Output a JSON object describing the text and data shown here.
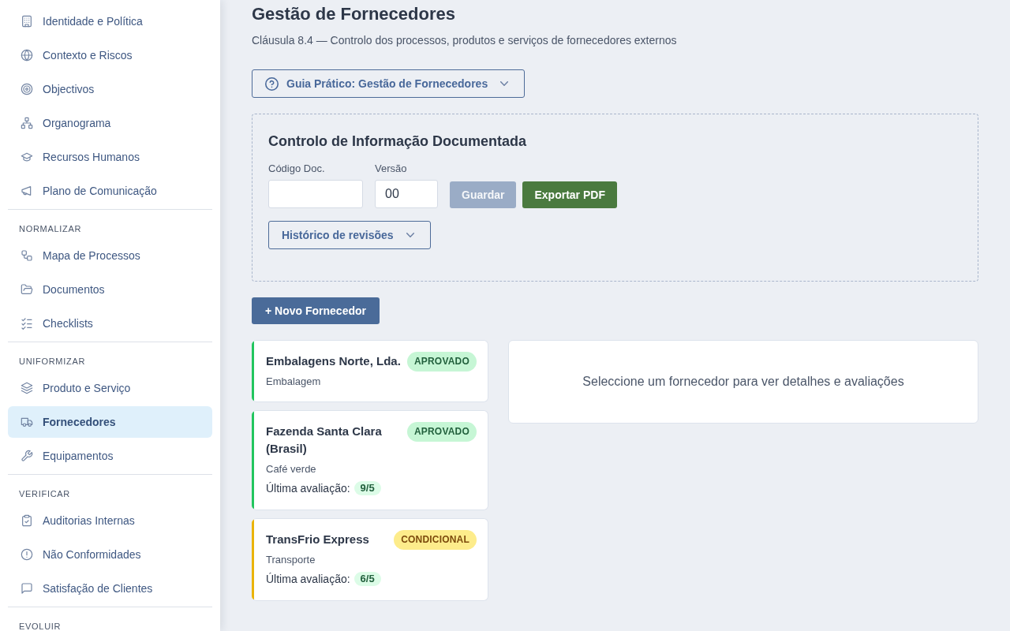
{
  "sidebar": {
    "sections": [
      {
        "items": [
          {
            "label": "Identidade e Política",
            "selected": false
          },
          {
            "label": "Contexto e Riscos",
            "selected": false
          },
          {
            "label": "Objectivos",
            "selected": false
          },
          {
            "label": "Organograma",
            "selected": false
          },
          {
            "label": "Recursos Humanos",
            "selected": false
          },
          {
            "label": "Plano de Comunicação",
            "selected": false
          }
        ]
      },
      {
        "heading": "NORMALIZAR",
        "items": [
          {
            "label": "Mapa de Processos",
            "selected": false
          },
          {
            "label": "Documentos",
            "selected": false
          },
          {
            "label": "Checklists",
            "selected": false
          }
        ]
      },
      {
        "heading": "UNIFORMIZAR",
        "items": [
          {
            "label": "Produto e Serviço",
            "selected": false
          },
          {
            "label": "Fornecedores",
            "selected": true
          },
          {
            "label": "Equipamentos",
            "selected": false
          }
        ]
      },
      {
        "heading": "VERIFICAR",
        "items": [
          {
            "label": "Auditorias Internas",
            "selected": false
          },
          {
            "label": "Não Conformidades",
            "selected": false
          },
          {
            "label": "Satisfação de Clientes",
            "selected": false
          }
        ]
      },
      {
        "heading": "EVOLUIR"
      }
    ]
  },
  "page": {
    "title": "Gestão de Fornecedores",
    "subtitle": "Cláusula 8.4 — Controlo dos processos, produtos e serviços de fornecedores externos"
  },
  "guide_button": {
    "label": "Guia Prático: Gestão de Fornecedores"
  },
  "document_control": {
    "title": "Controlo de Informação Documentada",
    "fields": [
      {
        "label": "Código Doc."
      },
      {
        "label": "Versão",
        "value": "00"
      }
    ],
    "buttons": [
      {
        "label": "Guardar",
        "kind": "primary",
        "disabled": true
      },
      {
        "label": "Exportar PDF",
        "kind": "success",
        "disabled": false
      }
    ],
    "history_button": {
      "label": "Histórico de revisões"
    }
  },
  "new_supplier_button": {
    "label": "+ Novo Fornecedor"
  },
  "suppliers": [
    {
      "name": "Embalagens Norte, Lda.",
      "category": "Embalagem",
      "color": "#22c55e",
      "selected": false,
      "status": {
        "label": "APROVADO",
        "kind": "approved"
      }
    },
    {
      "name": "Fazenda Santa Clara (Brasil)",
      "category": "Café verde",
      "color": "#22c55e",
      "selected": false,
      "status": {
        "label": "APROVADO",
        "kind": "approved"
      },
      "rating": {
        "label": "Última avaliação:",
        "value": "9/5"
      }
    },
    {
      "name": "TransFrio Express",
      "category": "Transporte",
      "color": "#eab308",
      "selected": false,
      "status": {
        "label": "CONDICIONAL",
        "kind": "conditional"
      },
      "rating": {
        "label": "Última avaliação:",
        "value": "6/5"
      }
    }
  ],
  "detail_panel": {
    "message": "Seleccione um fornecedor para ver detalhes e avaliações"
  }
}
